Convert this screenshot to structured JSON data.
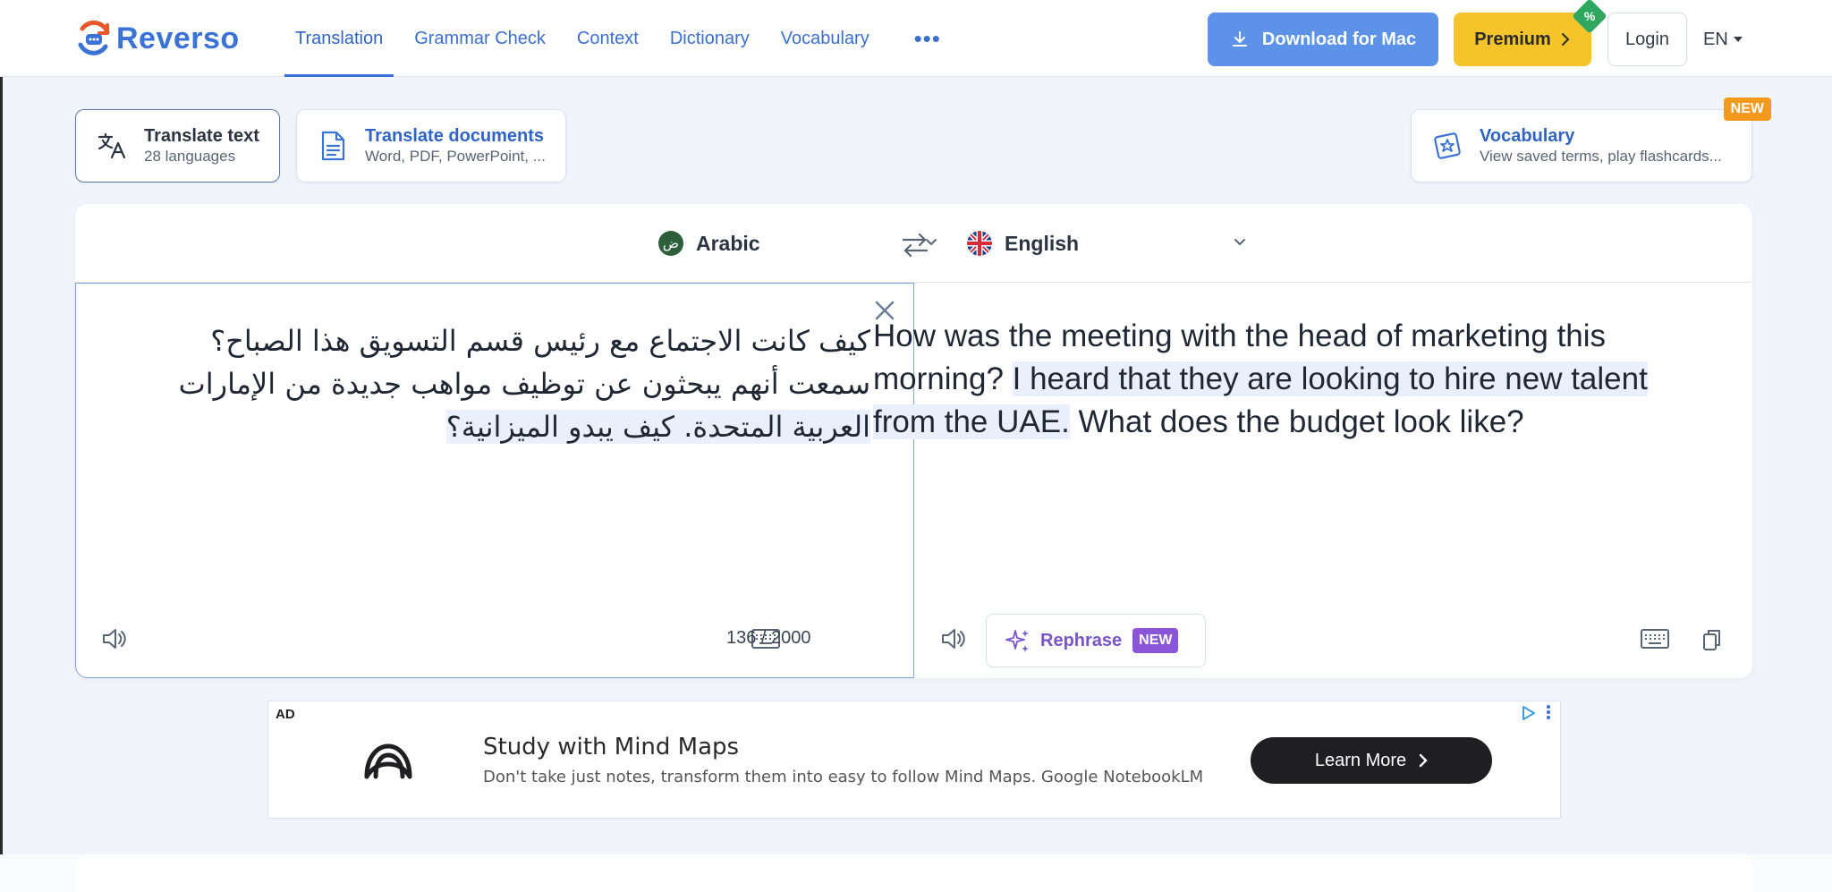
{
  "brand": {
    "name": "Reverso"
  },
  "nav": {
    "items": [
      {
        "label": "Translation",
        "active": true
      },
      {
        "label": "Grammar Check"
      },
      {
        "label": "Context"
      },
      {
        "label": "Dictionary"
      },
      {
        "label": "Vocabulary"
      }
    ],
    "more_label": "•••"
  },
  "header": {
    "download_label": "Download for Mac",
    "premium_label": "Premium",
    "premium_badge": "%",
    "login_label": "Login",
    "ui_language": "EN"
  },
  "tools": {
    "translate_text": {
      "title": "Translate text",
      "subtitle": "28 languages"
    },
    "translate_docs": {
      "title": "Translate documents",
      "subtitle": "Word, PDF, PowerPoint, ..."
    },
    "vocabulary": {
      "title": "Vocabulary",
      "subtitle": "View saved terms, play flashcards...",
      "badge": "NEW"
    }
  },
  "translator": {
    "source_language": "Arabic",
    "source_flag_glyph": "ض",
    "target_language": "English",
    "source_lines": [
      "كيف كانت الاجتماع مع رئيس قسم التسويق هذا الصباح؟",
      "سمعت أنهم يبحثون عن توظيف مواهب جديدة من الإمارات",
      "العربية المتحدة. كيف يبدو الميزانية؟"
    ],
    "target_text": {
      "part1": "How was the meeting with the head of marketing this morning? ",
      "highlight": "I heard that they are looking to hire new talent from the UAE.",
      "part2": " What does the budget look like?"
    },
    "char_count": "136 / 2000",
    "rephrase_label": "Rephrase",
    "rephrase_badge": "NEW"
  },
  "ad": {
    "label": "AD",
    "title": "Study with Mind Maps",
    "description": "Don't take just notes, transform them into easy to follow Mind Maps. Google NotebookLM",
    "button_label": "Learn More"
  },
  "colors": {
    "accent": "#3b73d5",
    "download_bg": "#5c93e8",
    "premium_bg": "#f4c42a",
    "rephrase": "#7a54c9",
    "new_badge": "#f39a1c"
  }
}
